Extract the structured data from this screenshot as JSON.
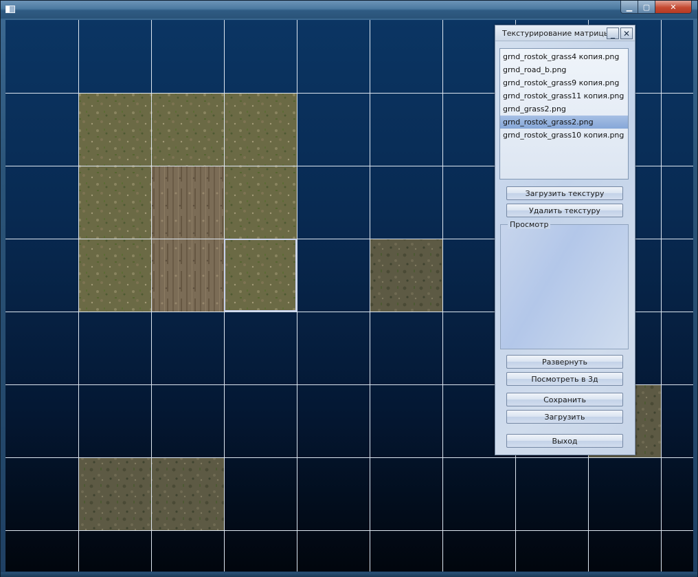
{
  "window": {
    "controls": {
      "minimize": "▁",
      "maximize": "▢",
      "close": "✕"
    }
  },
  "scene": {
    "grid": {
      "columns": 10,
      "rows": 8
    },
    "tiles": [
      {
        "col": 1,
        "row": 1,
        "texture": "grass"
      },
      {
        "col": 2,
        "row": 1,
        "texture": "grass"
      },
      {
        "col": 3,
        "row": 1,
        "texture": "grass"
      },
      {
        "col": 1,
        "row": 2,
        "texture": "grass"
      },
      {
        "col": 2,
        "row": 2,
        "texture": "road"
      },
      {
        "col": 3,
        "row": 2,
        "texture": "grass"
      },
      {
        "col": 1,
        "row": 3,
        "texture": "grass"
      },
      {
        "col": 2,
        "row": 3,
        "texture": "road"
      },
      {
        "col": 3,
        "row": 3,
        "texture": "grass",
        "selected": true
      },
      {
        "col": 5,
        "row": 3,
        "texture": "mud"
      },
      {
        "col": 8,
        "row": 5,
        "texture": "mud"
      },
      {
        "col": 1,
        "row": 6,
        "texture": "mud"
      },
      {
        "col": 2,
        "row": 6,
        "texture": "mud"
      }
    ],
    "colors": {
      "grid_line": "#dfe8f2",
      "grass": "#6b6a45",
      "road": "#7b6c56",
      "mud": "#5d5a44",
      "selection": "#c8d2ec"
    }
  },
  "panel": {
    "title": "Текстурирование матрицы",
    "min_glyph": "_",
    "close_glyph": "✕",
    "files": [
      "grnd_rostok_grass4 копия.png",
      "grnd_road_b.png",
      "grnd_rostok_grass9 копия.png",
      "grnd_rostok_grass11 копия.png",
      "grnd_grass2.png",
      "grnd_rostok_grass2.png",
      "grnd_rostok_grass10 копия.png"
    ],
    "selected_index": 5,
    "buttons": {
      "load_texture": "Загрузить текстуру",
      "delete_texture": "Удалить текстуру",
      "expand": "Развернуть",
      "view_3d": "Посмотреть в 3д",
      "save": "Сохранить",
      "load": "Загрузить",
      "exit": "Выход"
    },
    "preview_label": "Просмотр"
  }
}
